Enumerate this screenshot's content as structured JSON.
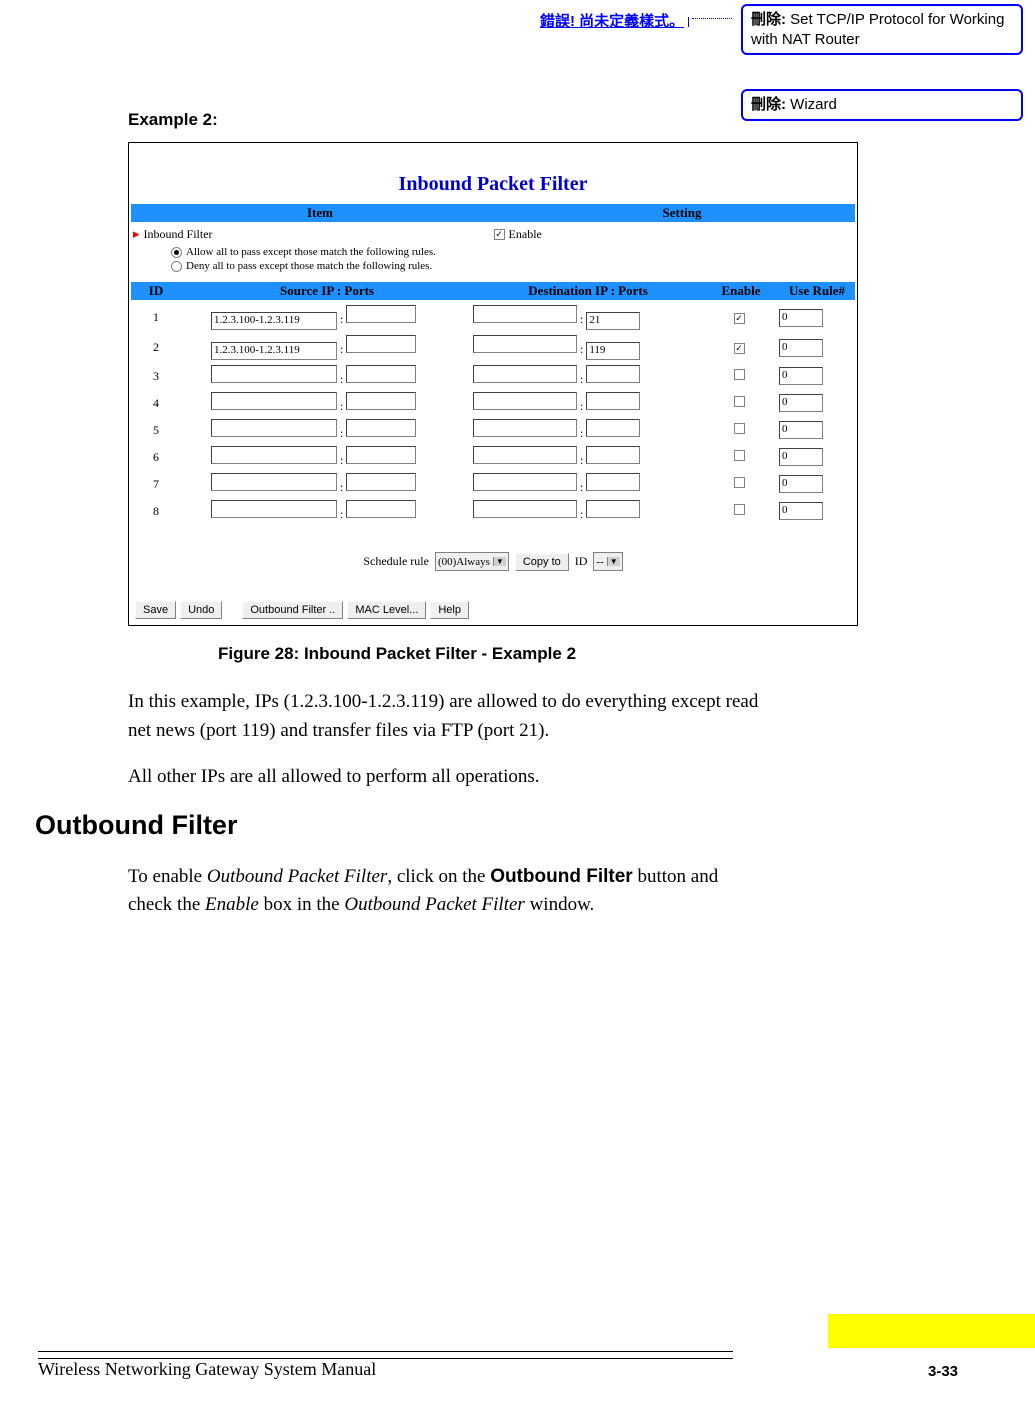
{
  "header_error": "錯誤! 尚未定義樣式。",
  "comments": [
    {
      "label": "刪除:",
      "text": " Set TCP/IP Protocol for Working with NAT Router"
    },
    {
      "label": "刪除:",
      "text": " Wizard"
    }
  ],
  "example_label": "Example 2:",
  "figure": {
    "title": "Inbound Packet Filter",
    "section_head": {
      "item": "Item",
      "setting": "Setting"
    },
    "inbound_label": "Inbound Filter",
    "enable_cb_label": "Enable",
    "allow_text": "Allow all to pass except those match the following rules.",
    "deny_text": "Deny all to pass except those match the following rules.",
    "cols": {
      "id": "ID",
      "src": "Source IP : Ports",
      "dst": "Destination IP : Ports",
      "enable": "Enable",
      "rule": "Use Rule#"
    },
    "rows": [
      {
        "id": "1",
        "src_ip": "1.2.3.100-1.2.3.119",
        "src_port": "",
        "dst_ip": "",
        "dst_port": "21",
        "enabled": true,
        "rule": "0"
      },
      {
        "id": "2",
        "src_ip": "1.2.3.100-1.2.3.119",
        "src_port": "",
        "dst_ip": "",
        "dst_port": "119",
        "enabled": true,
        "rule": "0"
      },
      {
        "id": "3",
        "src_ip": "",
        "src_port": "",
        "dst_ip": "",
        "dst_port": "",
        "enabled": false,
        "rule": "0"
      },
      {
        "id": "4",
        "src_ip": "",
        "src_port": "",
        "dst_ip": "",
        "dst_port": "",
        "enabled": false,
        "rule": "0"
      },
      {
        "id": "5",
        "src_ip": "",
        "src_port": "",
        "dst_ip": "",
        "dst_port": "",
        "enabled": false,
        "rule": "0"
      },
      {
        "id": "6",
        "src_ip": "",
        "src_port": "",
        "dst_ip": "",
        "dst_port": "",
        "enabled": false,
        "rule": "0"
      },
      {
        "id": "7",
        "src_ip": "",
        "src_port": "",
        "dst_ip": "",
        "dst_port": "",
        "enabled": false,
        "rule": "0"
      },
      {
        "id": "8",
        "src_ip": "",
        "src_port": "",
        "dst_ip": "",
        "dst_port": "",
        "enabled": false,
        "rule": "0"
      }
    ],
    "schedule_label": "Schedule rule",
    "schedule_value": "(00)Always",
    "copyto_label": "Copy to",
    "id_label": "ID",
    "id_sel": "--",
    "buttons": {
      "save": "Save",
      "undo": "Undo",
      "outbound": "Outbound Filter ..",
      "mac": "MAC Level...",
      "help": "Help"
    }
  },
  "figure_caption": "Figure 28: Inbound Packet Filter - Example 2",
  "para1": "In this example, IPs (1.2.3.100-1.2.3.119) are allowed to do everything except read net news (port 119) and transfer files via FTP (port 21).",
  "para2": "All other IPs are all allowed to perform all operations.",
  "h2": "Outbound Filter",
  "para3_a": "To enable ",
  "para3_b": "Outbound Packet Filter",
  "para3_c": ", click on the ",
  "para3_d": "Outbound Filter",
  "para3_e": " button and check the ",
  "para3_f": "Enable",
  "para3_g": " box in the ",
  "para3_h": "Outbound Packet Filter",
  "para3_i": " window.",
  "footer_text": "Wireless Networking Gateway System Manual",
  "page_num": "3-33"
}
